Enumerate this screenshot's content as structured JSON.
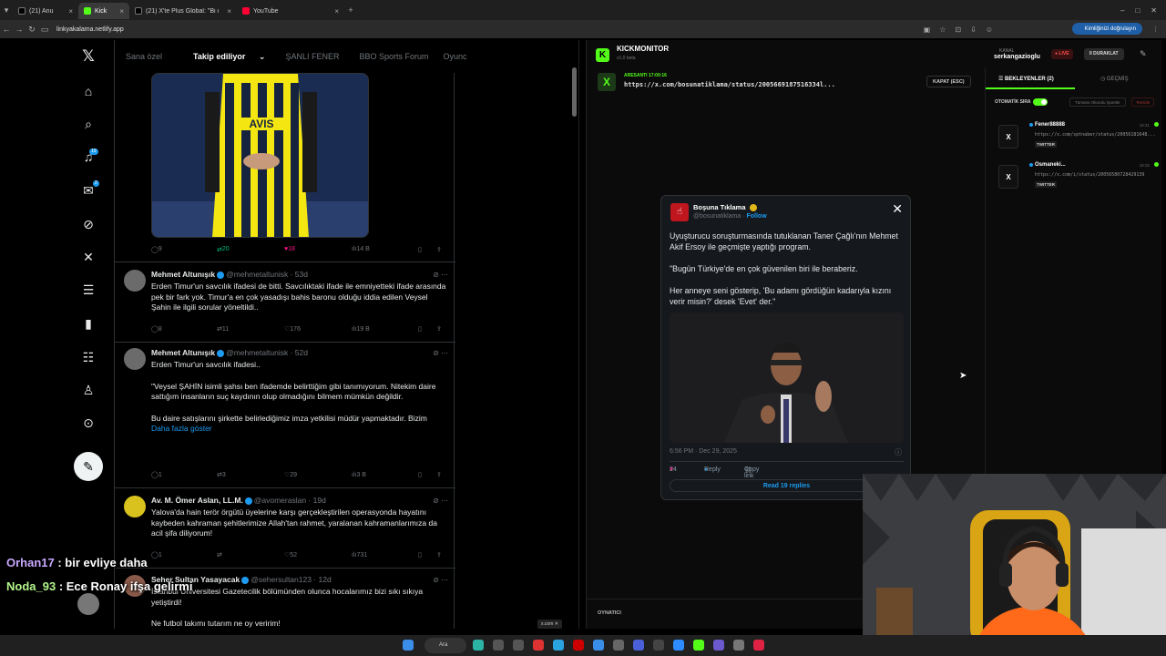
{
  "browser": {
    "tabs": [
      {
        "label": "(21) Anu"
      },
      {
        "label": "Kick"
      },
      {
        "label": "(21) X'te Plus Global: \"Bi oyun"
      },
      {
        "label": "YouTube"
      }
    ],
    "url": "linkyakalama.netlify.app",
    "verify_label": "Kimliğinizi doğrulayın"
  },
  "x": {
    "feed_tabs": [
      "Sana özel",
      "Takip ediliyor",
      "ŞANLI FENER",
      "BBO Sports Forum",
      "Oyunc"
    ],
    "badges": {
      "notifications": "19",
      "messages": "2"
    },
    "top_post_actions": {
      "replies": "9",
      "reposts": "20",
      "likes": "18",
      "views": "14 B"
    },
    "tweets": [
      {
        "name": "Mehmet Altunışık",
        "handle": "@mehmetaltunisk · 53d",
        "text": "Erden Timur'un savcılık ifadesi de bitti. Savcılıktaki ifade ile emniyetteki ifade arasında pek bir fark yok. Timur'a en çok yasadışı bahis baronu olduğu iddia edilen Veysel Şahin ile ilgili sorular yöneltildi..",
        "replies": "8",
        "reposts": "11",
        "likes": "176",
        "views": "19 B"
      },
      {
        "name": "Mehmet Altunışık",
        "handle": "@mehmetaltunisk · 52d",
        "text1": "Erden Timur'un savcılık ifadesi..",
        "text2": "\"Veysel ŞAHİN isimli şahsı ben ifademde belirttiğim gibi tanımıyorum. Nitekim daire sattığım insanların suç kaydının olup olmadığını bilmem mümkün değildir.",
        "text3": "Bu daire satışlarını şirkette belirlediğimiz imza yetkilisi müdür yapmaktadır. Bizim",
        "more": "Daha fazla göster",
        "replies": "1",
        "reposts": "3",
        "likes": "29",
        "views": "3 B"
      },
      {
        "name": "Av. M. Ömer Aslan, LL.M.",
        "handle": "@avomeraslan · 19d",
        "text": "Yalova'da hain terör örgütü üyelerine karşı gerçekleştirilen operasyonda hayatını kaybeden kahraman şehitlerimize Allah'tan rahmet, yaralanan kahramanlarımıza da acil şifa diliyorum!",
        "replies": "1",
        "reposts": "",
        "likes": "52",
        "views": "731"
      },
      {
        "name": "Seher Sultan Yasayacak",
        "handle": "@sehersultan123 · 12d",
        "text": "İstanbul Üniversitesi Gazetecilik bölümünden olunca hocalarımız bizi sıkı sıkıya yetiştirdi!",
        "text2": "Ne futbol takımı tutarım ne oy veririm!"
      }
    ]
  },
  "chat": [
    {
      "user": "Orhan17",
      "msg": " : bir evliye daha"
    },
    {
      "user": "Noda_93",
      "msg": " : Ece Ronay ifşa gelirmi"
    }
  ],
  "kick_monitor": {
    "title": "KICKMONITOR",
    "version": "v1.0 beta",
    "current_user": "ARESANTI 17:00:16",
    "current_url": "https://x.com/bosunatiklama/status/2005669187516334l...",
    "close_label": "KAPAT (ESC)",
    "channel_label": "KANAL",
    "channel": "serkangazioglu",
    "live": "● LIVE",
    "pause": "II DURAKLAT",
    "tab_waiting": "BEKLEYENLER (2)",
    "tab_history": "GEÇMİŞ",
    "auto_label": "OTOMATİK SIRA",
    "all_label": "Tümünü Okundu İşaretle",
    "clear_label": "Temizle",
    "queue": [
      {
        "name": "Fener88888",
        "url": "https://x.com/sptnaber/status/20056181648...",
        "tag": "TWITTER",
        "time": "18:31",
        "icon": "X"
      },
      {
        "name": "Osmaneki...",
        "url": "https://x.com/i/status/20056580728429139",
        "tag": "TWITTER",
        "time": "18:32",
        "icon": "X"
      }
    ],
    "player_label": "OYNATICI"
  },
  "card": {
    "name": "Boşuna Tıklama",
    "handle": "@bosunatiklama",
    "follow": "Follow",
    "p1": "Uyuşturucu soruşturmasında tutuklanan Taner Çağlı'nın Mehmet Akif Ersoy ile geçmişte yaptığı program.",
    "p2": "\"Bugün Türkiye'de en çok güvenilen biri ile beraberiz.",
    "p3": "Her anneye seni gösterip, 'Bu adamı gördüğün kadarıyla kızını verir misin?' desek 'Evet' der.\"",
    "meta": "6:56 PM · Dec 29, 2025",
    "likes": "24",
    "reply": "Reply",
    "copy": "Copy link",
    "read_replies": "Read 19 replies"
  },
  "tinytab": "x.com",
  "taskbar": {
    "search": "Ara"
  }
}
